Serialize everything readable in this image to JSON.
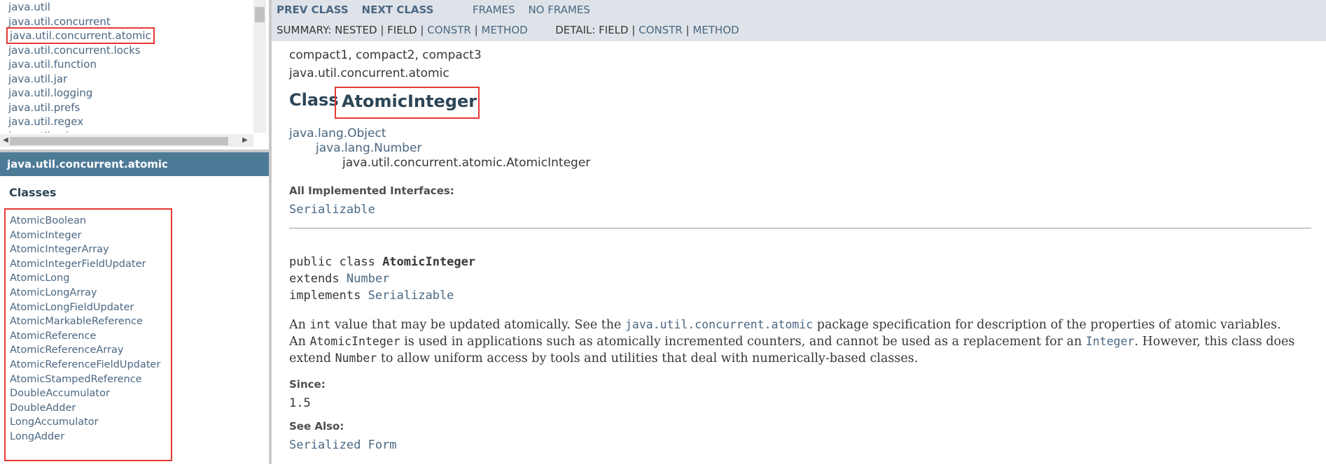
{
  "packages_frame": {
    "items": [
      "java.util",
      "java.util.concurrent",
      "java.util.concurrent.atomic",
      "java.util.concurrent.locks",
      "java.util.function",
      "java.util.jar",
      "java.util.logging",
      "java.util.prefs",
      "java.util.regex",
      "java.util.spi"
    ],
    "selected_index": 2
  },
  "package_frame": {
    "header": "java.util.concurrent.atomic",
    "classes_heading": "Classes",
    "classes": [
      "AtomicBoolean",
      "AtomicInteger",
      "AtomicIntegerArray",
      "AtomicIntegerFieldUpdater",
      "AtomicLong",
      "AtomicLongArray",
      "AtomicLongFieldUpdater",
      "AtomicMarkableReference",
      "AtomicReference",
      "AtomicReferenceArray",
      "AtomicReferenceFieldUpdater",
      "AtomicStampedReference",
      "DoubleAccumulator",
      "DoubleAdder",
      "LongAccumulator",
      "LongAdder"
    ]
  },
  "nav": {
    "prev_class": "Prev Class",
    "next_class": "Next Class",
    "frames": "Frames",
    "no_frames": "No Frames",
    "summary_label": "Summary:",
    "summary_nested": "Nested",
    "summary_field": "Field",
    "summary_constr": "Constr",
    "summary_method": "Method",
    "detail_label": "Detail:",
    "detail_field": "Field",
    "detail_constr": "Constr",
    "detail_method": "Method",
    "separator": "|"
  },
  "class_page": {
    "profiles": "compact1, compact2, compact3",
    "package": "java.util.concurrent.atomic",
    "title_prefix": "Class",
    "title_name": "AtomicInteger",
    "inheritance": {
      "level1": "java.lang.Object",
      "level2": "java.lang.Number",
      "level3": "java.util.concurrent.atomic.AtomicInteger"
    },
    "implemented_label": "All Implemented Interfaces:",
    "implemented_value": "Serializable",
    "declaration": {
      "line1_prefix": "public class ",
      "line1_name": "AtomicInteger",
      "line2_prefix": "extends ",
      "line2_link": "Number",
      "line3_prefix": "implements ",
      "line3_link": "Serializable"
    },
    "description": {
      "p1_a": "An ",
      "p1_code1": "int",
      "p1_b": " value that may be updated atomically. See the ",
      "p1_link": "java.util.concurrent.atomic",
      "p1_c": " package specification for description of the properties of atomic variables.",
      "p2_a": "An ",
      "p2_code1": "AtomicInteger",
      "p2_b": " is used in applications such as atomically incremented counters, and cannot be used as a replacement for an ",
      "p2_link": "Integer",
      "p2_c": ". However, this class does",
      "p3_a": "extend ",
      "p3_code1": "Number",
      "p3_b": " to allow uniform access by tools and utilities that deal with numerically-based classes."
    },
    "since_label": "Since:",
    "since_value": "1.5",
    "see_also_label": "See Also:",
    "see_also_value": "Serialized Form"
  },
  "colors": {
    "link": "#4A6782",
    "nav_bg": "#dee3e9",
    "package_header_bg": "#4D7A97",
    "highlight_box": "#e53935"
  }
}
